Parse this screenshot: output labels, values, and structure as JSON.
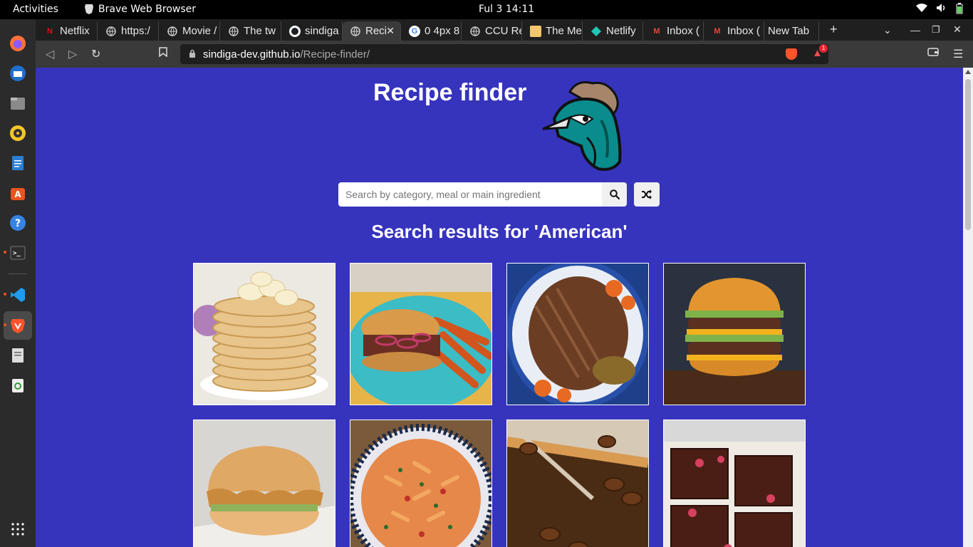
{
  "topbar": {
    "activities": "Activities",
    "app_name": "Brave Web Browser",
    "clock": "Ful 3  14:11"
  },
  "tabs": [
    {
      "label": "Netflix",
      "icon": "netflix-icon"
    },
    {
      "label": "https:/",
      "icon": "globe-icon"
    },
    {
      "label": "Movie /",
      "icon": "globe-icon"
    },
    {
      "label": "The tw",
      "icon": "globe-icon"
    },
    {
      "label": "sindiga",
      "icon": "github-icon"
    },
    {
      "label": "Reci",
      "icon": "globe-icon"
    },
    {
      "label": "0 4px 8",
      "icon": "google-icon"
    },
    {
      "label": "CCU Re",
      "icon": "globe-icon"
    },
    {
      "label": "The Me",
      "icon": "avatar-icon"
    },
    {
      "label": "Netlify",
      "icon": "netlify-icon"
    },
    {
      "label": "Inbox (",
      "icon": "gmail-icon"
    },
    {
      "label": "Inbox (",
      "icon": "gmail-icon"
    },
    {
      "label": "New Tab",
      "icon": ""
    }
  ],
  "url": {
    "host": "sindiga-dev.github.io",
    "path": "/Recipe-finder/"
  },
  "shields_badge": "1",
  "page": {
    "title": "Recipe finder",
    "search_placeholder": "Search by category, meal or main ingredient",
    "results_heading": "Search results for 'American'"
  },
  "meals": [
    {
      "name": "pancakes-meal"
    },
    {
      "name": "burger-fries-meal"
    },
    {
      "name": "brisket-meal"
    },
    {
      "name": "double-burger-meal"
    },
    {
      "name": "chicken-sandwich-meal"
    },
    {
      "name": "pasta-meal"
    },
    {
      "name": "pecan-pie-meal"
    },
    {
      "name": "brownies-meal"
    }
  ],
  "colors": {
    "page_bg": "#3633bd",
    "accent_brave": "#fb542b"
  }
}
